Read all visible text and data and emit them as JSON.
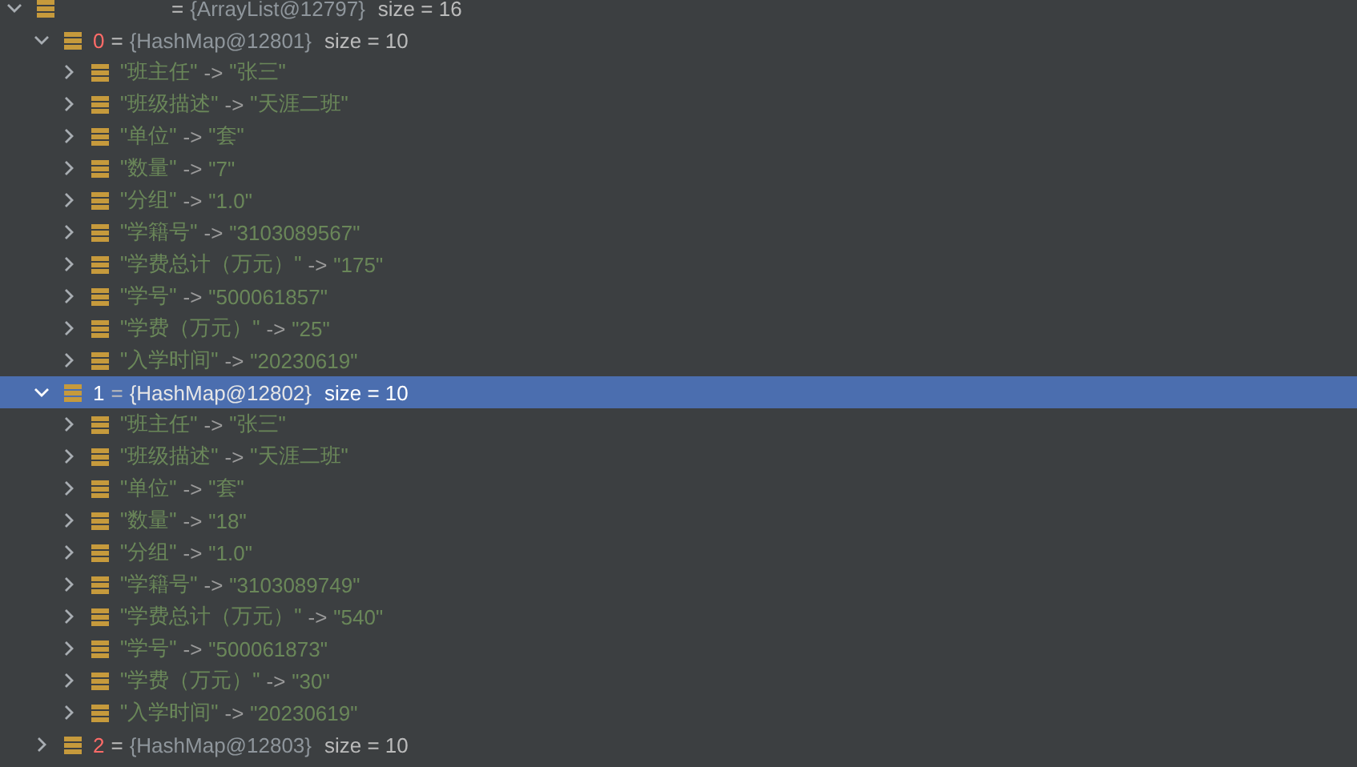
{
  "variables": {
    "kind": "object",
    "expanded": true,
    "selected": false,
    "assign": "=",
    "type": "{ArrayList@12797}",
    "size": "size = 16",
    "children": [
      {
        "kind": "object",
        "index": "0",
        "assign": "=",
        "type": "{HashMap@12801}",
        "size": "size = 10",
        "expanded": true,
        "selected": false,
        "children": [
          {
            "kind": "entry",
            "key": "\"班主任\"",
            "separator": "->",
            "value": "\"张三\"",
            "expanded": false
          },
          {
            "kind": "entry",
            "key": "\"班级描述\"",
            "separator": "->",
            "value": "\"天涯二班\"",
            "expanded": false
          },
          {
            "kind": "entry",
            "key": "\"单位\"",
            "separator": "->",
            "value": "\"套\"",
            "expanded": false
          },
          {
            "kind": "entry",
            "key": "\"数量\"",
            "separator": "->",
            "value": "\"7\"",
            "expanded": false
          },
          {
            "kind": "entry",
            "key": "\"分组\"",
            "separator": "->",
            "value": "\"1.0\"",
            "expanded": false
          },
          {
            "kind": "entry",
            "key": "\"学籍号\"",
            "separator": "->",
            "value": "\"3103089567\"",
            "expanded": false
          },
          {
            "kind": "entry",
            "key": "\"学费总计（万元）\"",
            "separator": "->",
            "value": "\"175\"",
            "expanded": false
          },
          {
            "kind": "entry",
            "key": "\"学号\"",
            "separator": "->",
            "value": "\"500061857\"",
            "expanded": false
          },
          {
            "kind": "entry",
            "key": "\"学费（万元）\"",
            "separator": "->",
            "value": "\"25\"",
            "expanded": false
          },
          {
            "kind": "entry",
            "key": "\"入学时间\"",
            "separator": "->",
            "value": "\"20230619\"",
            "expanded": false
          }
        ]
      },
      {
        "kind": "object",
        "index": "1",
        "assign": "=",
        "type": "{HashMap@12802}",
        "size": "size = 10",
        "expanded": true,
        "selected": true,
        "children": [
          {
            "kind": "entry",
            "key": "\"班主任\"",
            "separator": "->",
            "value": "\"张三\"",
            "expanded": false
          },
          {
            "kind": "entry",
            "key": "\"班级描述\"",
            "separator": "->",
            "value": "\"天涯二班\"",
            "expanded": false
          },
          {
            "kind": "entry",
            "key": "\"单位\"",
            "separator": "->",
            "value": "\"套\"",
            "expanded": false
          },
          {
            "kind": "entry",
            "key": "\"数量\"",
            "separator": "->",
            "value": "\"18\"",
            "expanded": false
          },
          {
            "kind": "entry",
            "key": "\"分组\"",
            "separator": "->",
            "value": "\"1.0\"",
            "expanded": false
          },
          {
            "kind": "entry",
            "key": "\"学籍号\"",
            "separator": "->",
            "value": "\"3103089749\"",
            "expanded": false
          },
          {
            "kind": "entry",
            "key": "\"学费总计（万元）\"",
            "separator": "->",
            "value": "\"540\"",
            "expanded": false
          },
          {
            "kind": "entry",
            "key": "\"学号\"",
            "separator": "->",
            "value": "\"500061873\"",
            "expanded": false
          },
          {
            "kind": "entry",
            "key": "\"学费（万元）\"",
            "separator": "->",
            "value": "\"30\"",
            "expanded": false
          },
          {
            "kind": "entry",
            "key": "\"入学时间\"",
            "separator": "->",
            "value": "\"20230619\"",
            "expanded": false
          }
        ]
      },
      {
        "kind": "object",
        "index": "2",
        "assign": "=",
        "type": "{HashMap@12803}",
        "size": "size = 10",
        "expanded": false,
        "selected": false
      }
    ]
  }
}
